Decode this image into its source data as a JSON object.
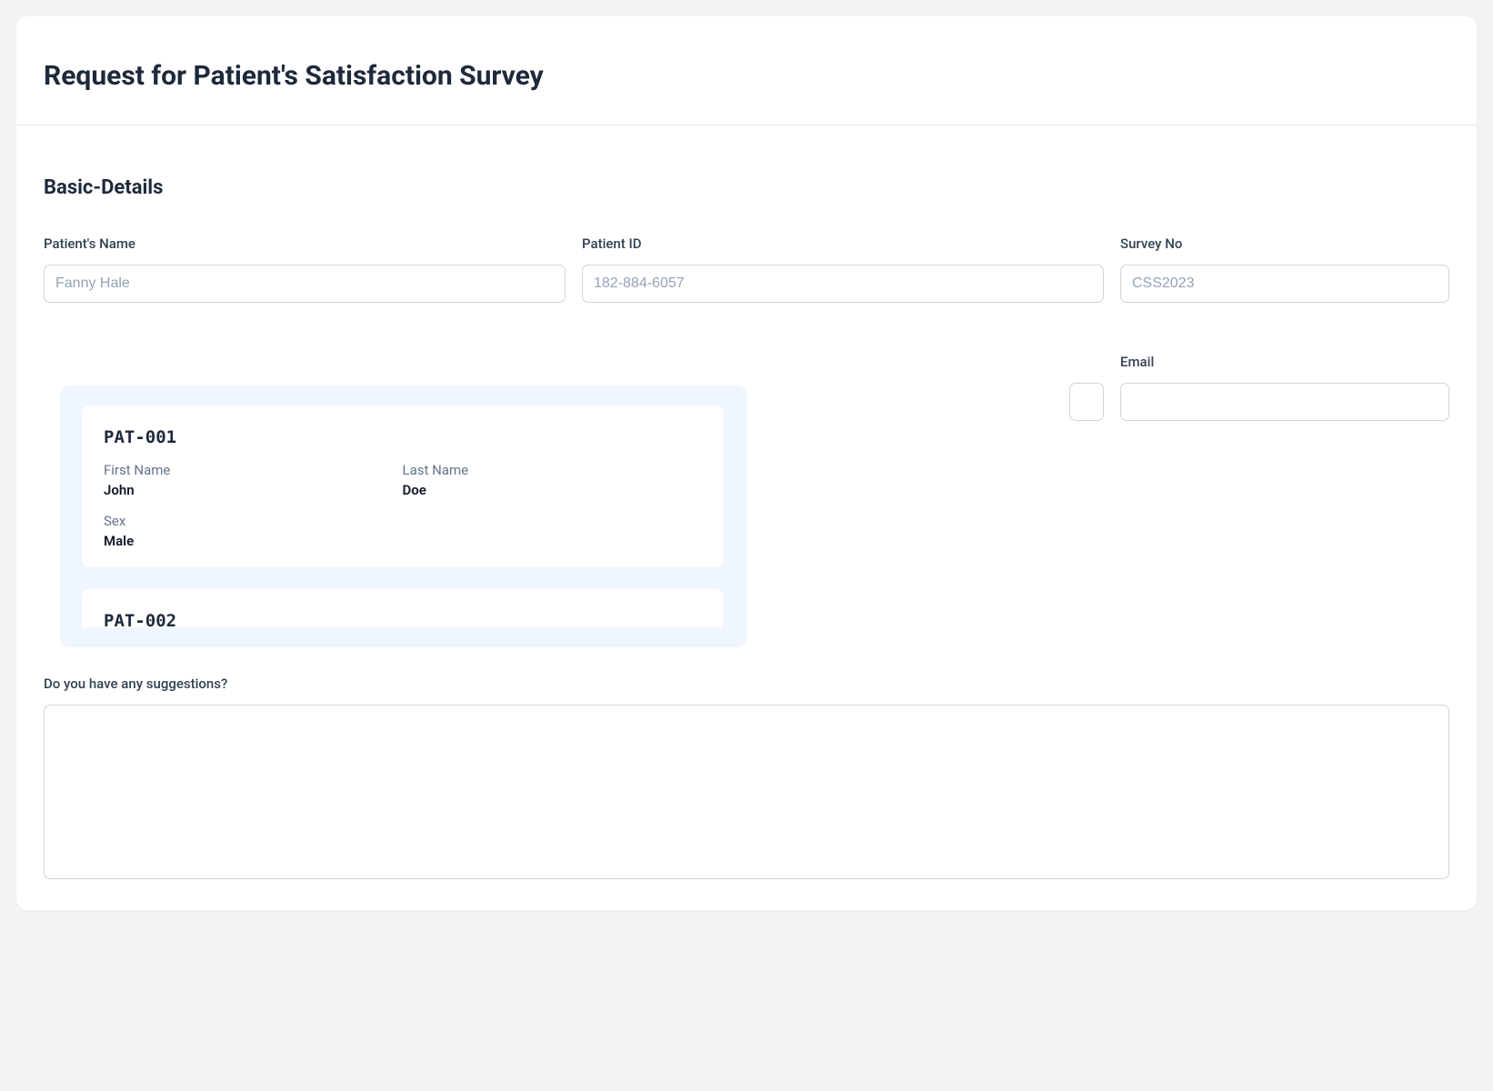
{
  "page": {
    "title": "Request for Patient's Satisfaction Survey"
  },
  "section": {
    "title": "Basic-Details"
  },
  "fields": {
    "patient_name": {
      "label": "Patient's Name",
      "placeholder": "Fanny Hale",
      "value": ""
    },
    "patient_id": {
      "label": "Patient ID",
      "placeholder": "182-884-6057",
      "value": ""
    },
    "survey_no": {
      "label": "Survey No",
      "placeholder": "CSS2023",
      "value": ""
    },
    "email": {
      "label": "Email",
      "placeholder": "",
      "value": ""
    },
    "suggestions": {
      "label": "Do you have any suggestions?"
    }
  },
  "autocomplete": {
    "options": [
      {
        "id": "PAT-001",
        "labels": {
          "first_name": "First Name",
          "last_name": "Last Name",
          "sex": "Sex"
        },
        "first_name": "John",
        "last_name": "Doe",
        "sex": "Male"
      },
      {
        "id": "PAT-002"
      }
    ]
  }
}
